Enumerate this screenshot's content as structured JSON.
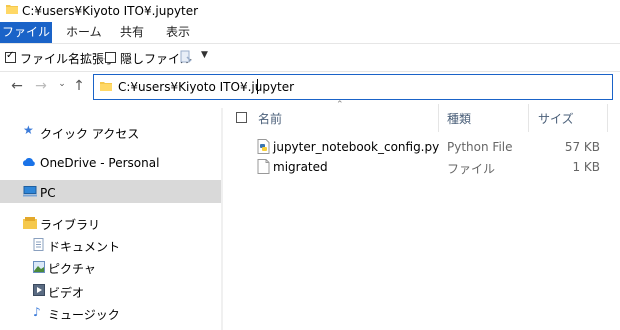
{
  "window": {
    "title": "C:¥users¥Kiyoto ITO¥.jupyter"
  },
  "ribbon": {
    "tabs": [
      {
        "label": "ファイル",
        "active": true
      },
      {
        "label": "ホーム"
      },
      {
        "label": "共有"
      },
      {
        "label": "表示"
      }
    ],
    "options": {
      "file_ext_label": "ファイル名拡張子",
      "file_ext_checked": true,
      "hidden_files_label": "隠しファイル",
      "hidden_files_checked": false
    }
  },
  "address": {
    "path": "C:¥users¥Kiyoto ITO¥.jupyter"
  },
  "nav": {
    "quick_access": "クイック アクセス",
    "onedrive": "OneDrive - Personal",
    "pc": "PC",
    "library": "ライブラリ",
    "documents": "ドキュメント",
    "pictures": "ピクチャ",
    "videos": "ビデオ",
    "music": "ミュージック"
  },
  "columns": {
    "name": "名前",
    "type": "種類",
    "size": "サイズ"
  },
  "files": [
    {
      "name": "jupyter_notebook_config.py",
      "type": "Python File",
      "size": "57 KB",
      "icon": "python-file-icon"
    },
    {
      "name": "migrated",
      "type": "ファイル",
      "size": "1 KB",
      "icon": "blank-file-icon"
    }
  ],
  "colors": {
    "accent": "#1a63c8",
    "selection": "#d9d9d9"
  }
}
